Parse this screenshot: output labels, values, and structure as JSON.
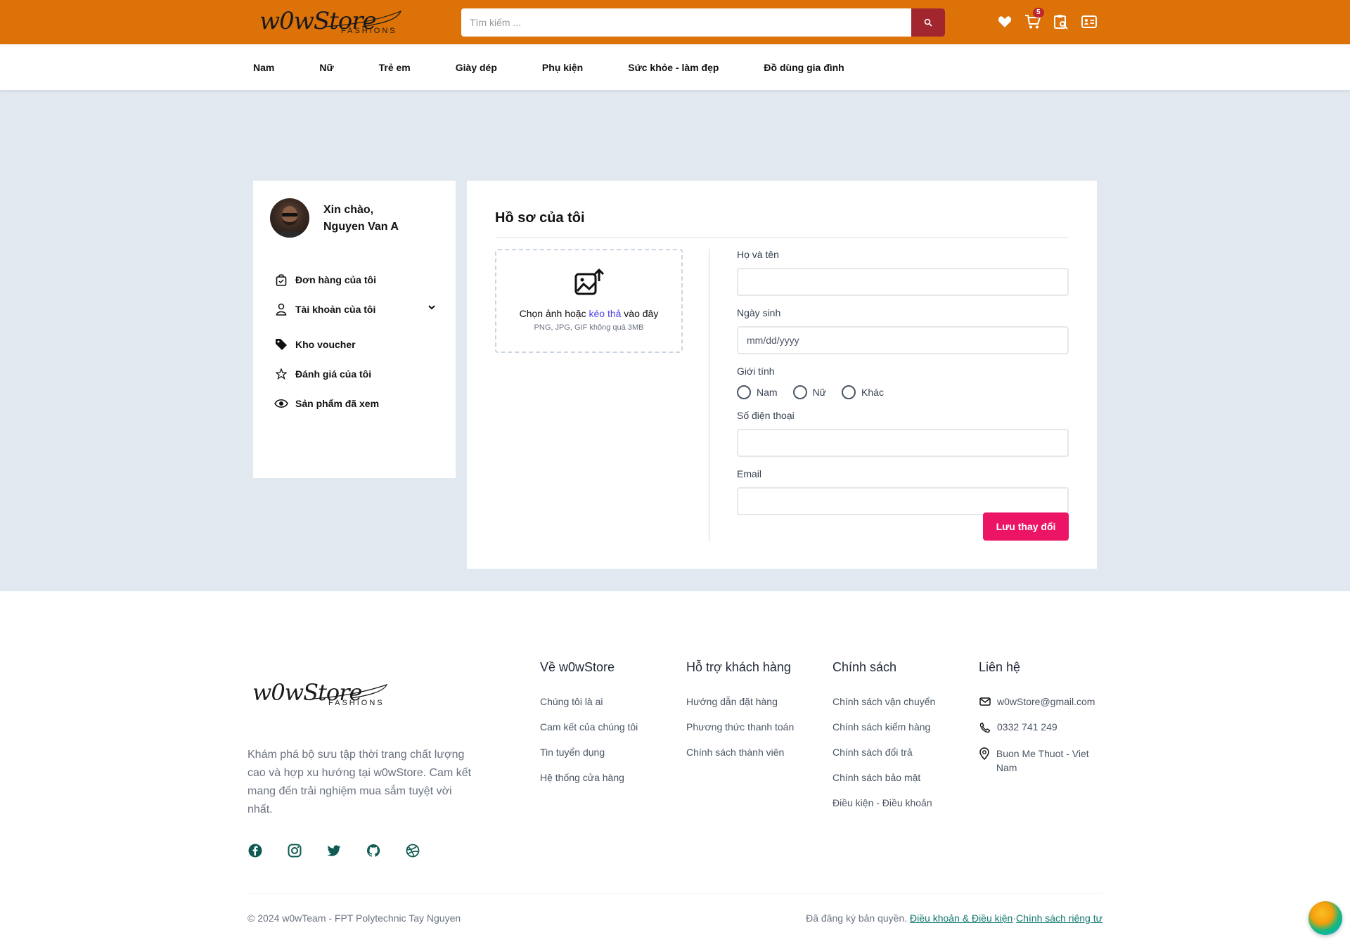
{
  "header": {
    "logo_script": "w0wStore",
    "logo_sub": "FASHIONS",
    "search_placeholder": "Tìm kiếm ...",
    "cart_count": "5"
  },
  "nav": {
    "items": [
      "Nam",
      "Nữ",
      "Trẻ em",
      "Giày dép",
      "Phụ kiện",
      "Sức khỏe - làm đẹp",
      "Đồ dùng gia đình"
    ]
  },
  "sidebar": {
    "greeting": "Xin chào,",
    "username": "Nguyen Van A",
    "items": [
      {
        "label": "Đơn hàng của tôi",
        "icon": "shopping-bag-icon"
      },
      {
        "label": "Tài khoản của tôi",
        "icon": "user-icon"
      },
      {
        "label": "Kho voucher",
        "icon": "tag-icon"
      },
      {
        "label": "Đánh giá của tôi",
        "icon": "star-icon"
      },
      {
        "label": "Sản phẩm đã xem",
        "icon": "eye-icon"
      }
    ]
  },
  "profile": {
    "title": "Hồ sơ của tôi",
    "upload_text_pre": "Chọn ảnh hoặc ",
    "upload_text_link": "kéo thả",
    "upload_text_post": " vào đây",
    "upload_hint": "PNG, JPG, GIF không quá 3MB",
    "fullname_label": "Họ và tên",
    "fullname_value": "",
    "dob_label": "Ngày sinh",
    "dob_placeholder": "mm/dd/yyyy",
    "gender_label": "Giới tính",
    "gender_options": [
      "Nam",
      "Nữ",
      "Khác"
    ],
    "phone_label": "Số điện thoại",
    "phone_value": "",
    "email_label": "Email",
    "email_value": "",
    "save_label": "Lưu thay đổi"
  },
  "footer": {
    "logo_script": "w0wStore",
    "logo_sub": "FASHIONS",
    "description": "Khám phá bộ sưu tập thời trang chất lượng cao và hợp xu hướng tại w0wStore. Cam kết mang đến trải nghiệm mua sắm tuyệt vời nhất.",
    "columns": [
      {
        "title": "Về w0wStore",
        "links": [
          "Chúng tôi là ai",
          "Cam kết của chúng tôi",
          "Tin tuyển dụng",
          "Hệ thống cửa hàng"
        ]
      },
      {
        "title": "Hỗ trợ khách hàng",
        "links": [
          "Hướng dẫn đặt hàng",
          "Phương thức thanh toán",
          "Chính sách thành viên"
        ]
      },
      {
        "title": "Chính sách",
        "links": [
          "Chính sách vận chuyển",
          "Chính sách kiểm hàng",
          "Chính sách đổi trả",
          "Chính sách bảo mật",
          "Điều kiện - Điều khoản"
        ]
      }
    ],
    "contact_title": "Liên hệ",
    "contact": {
      "email": "w0wStore@gmail.com",
      "phone": "0332 741 249",
      "address": "Buon Me Thuot - Viet Nam"
    },
    "copyright": "© 2024 w0wTeam - FPT Polytechnic Tay Nguyen",
    "rights_text": "Đã đăng ký bản quyền. ",
    "terms_link": "Điều khoản & Điều kiện",
    "separator": "·",
    "privacy_link": "Chính sách riêng tư"
  },
  "colors": {
    "header_bg": "#dc7208",
    "search_btn": "#a2262e",
    "save_btn": "#ec1565",
    "page_bg": "#e2e8f0",
    "footer_link": "#0f766e"
  }
}
